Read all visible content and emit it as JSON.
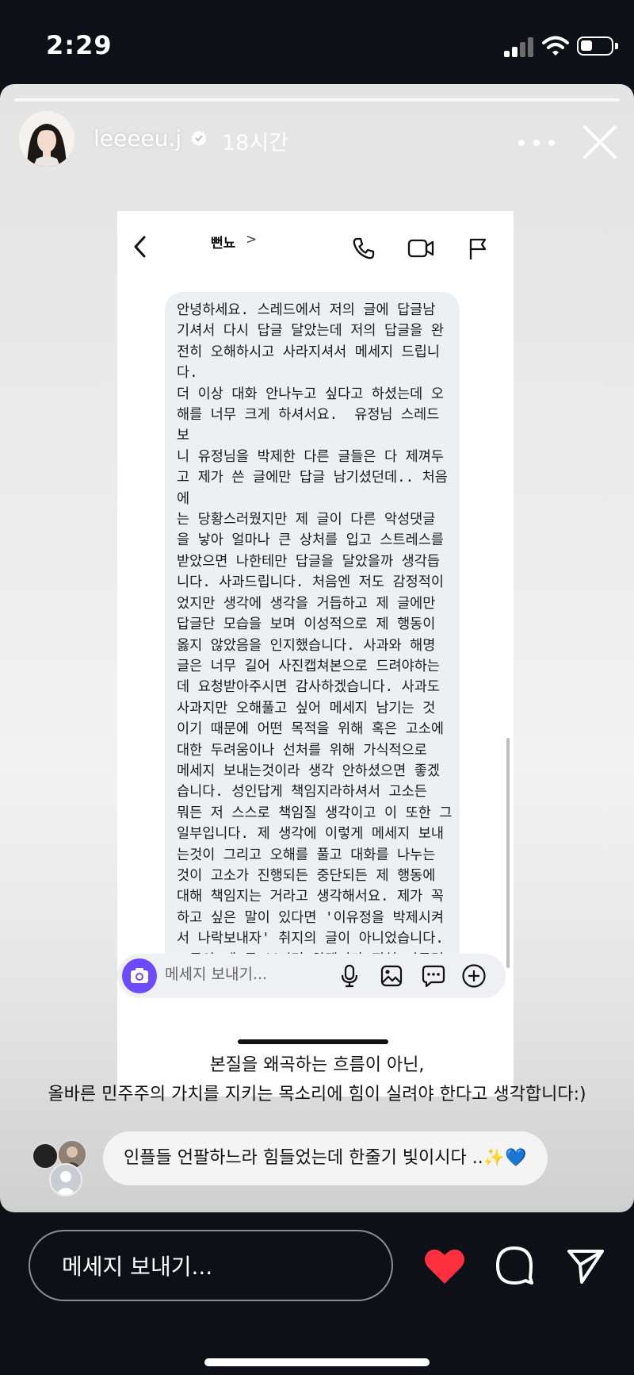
{
  "status_bar": {
    "time": "2:29"
  },
  "story": {
    "username": "leeeeu.j",
    "time_ago": "18시간",
    "caption_lines": [
      "본질을 왜곡하는 흐름이 아닌,",
      "올바른 민주주의 가치를 지키는 목소리에 힘이 실려야 한다고 생각합니다:)"
    ],
    "reply_text": "인플들 언팔하느라 힘들었는데 한줄기 빛이시다 ..✨💙"
  },
  "screenshot": {
    "contact_name": "뻔뇨",
    "contact_chevron": ">",
    "message": "안녕하세요. 스레드에서 저의 글에 답글남\n기셔서 다시 답글 달았는데 저의 답글을 완\n전히 오해하시고 사라지셔서 메세지 드립니\n다.\n더 이상 대화 안나누고 싶다고 하셨는데 오\n해를 너무 크게 하셔서요.  유정님 스레드 보\n니 유정님을 박제한 다른 글들은 다 제껴두\n고 제가 쓴 글에만 답글 남기셨던데.. 처음에\n는 당황스러웠지만 제 글이 다른 악성댓글\n을 낳아 얼마나 큰 상처를 입고 스트레스를\n받았으면 나한테만 답글을 달았을까 생각듭\n니다. 사과드립니다. 처음엔 저도 감정적이\n었지만 생각에 생각을 거듭하고 제 글에만\n답글단 모습을 보며 이성적으로 제 행동이\n옳지 않았음을 인지했습니다. 사과와 해명\n글은 너무 길어 사진캡쳐본으로 드려야하는\n데 요청받아주시면 감사하겠습니다. 사과도\n사과지만 오해풀고 싶어 메세지 남기는 것\n이기 때문에 어떤 목적을 위해 혹은 고소에\n대한 두려움이나 선처를 위해 가식적으로\n메세지 보내는것이라 생각 안하셨으면 좋겠\n습니다. 성인답게 책임지라하셔서 고소든\n뭐든 저 스스로 책임질 생각이고 이 또한 그\n일부입니다. 제 생각에 이렇게 메세지 보내\n는것이 그리고 오해를 풀고 대화를 나누는\n것이 고소가 진행되든 중단되든 제 행동에\n대해 책임지는 거라고 생각해서요. 제가 꼭\n하고 싶은 말이 있다면 '이유정을 박제시켜\n서 나락보내자' 취지의 글이 아니었습니다.\n그동안 제 글 보시면 알겠지만 전혀 파급력\n이 없어서 그렇게 조리돌림으로 변질되고\n상처입을 거라 미쳐 생각못했습니다. 이 부\n분 외면하지않고 사과할 수 있다고 말하고",
    "composer_placeholder": "메세지 보내기..."
  },
  "bottom_bar": {
    "message_placeholder": "메세지 보내기..."
  },
  "colors": {
    "accent_purple": "#6d4aff",
    "heart_red": "#ff3040",
    "background": "#0d1117"
  },
  "icons": [
    "back-icon",
    "call-icon",
    "video-icon",
    "flag-icon",
    "camera-icon",
    "mic-icon",
    "gallery-icon",
    "sticker-icon",
    "plus-icon",
    "heart-icon",
    "comment-icon",
    "send-icon",
    "close-icon",
    "more-icon",
    "verified-icon"
  ]
}
